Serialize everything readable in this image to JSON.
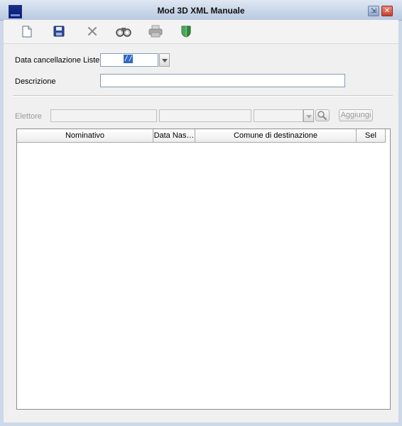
{
  "window": {
    "title": "Mod 3D XML Manuale"
  },
  "toolbar": {
    "items": [
      {
        "name": "new-document-icon"
      },
      {
        "name": "save-icon"
      },
      {
        "name": "delete-icon"
      },
      {
        "name": "binoculars-search-icon"
      },
      {
        "name": "print-icon"
      },
      {
        "name": "shield-icon"
      }
    ]
  },
  "form": {
    "data_cancellazione_label": "Data cancellazione Liste",
    "data_cancellazione_value": "/ /",
    "descrizione_label": "Descrizione",
    "descrizione_value": ""
  },
  "elettore": {
    "label": "Elettore",
    "add_button": "Aggiungi"
  },
  "grid": {
    "columns": [
      "Nominativo",
      "Data Nas…",
      "Comune di destinazione",
      "Sel"
    ],
    "rows": []
  },
  "colors": {
    "accent_blue": "#3168c5",
    "shield_green": "#2e8b3a",
    "close_red": "#c8432e"
  }
}
